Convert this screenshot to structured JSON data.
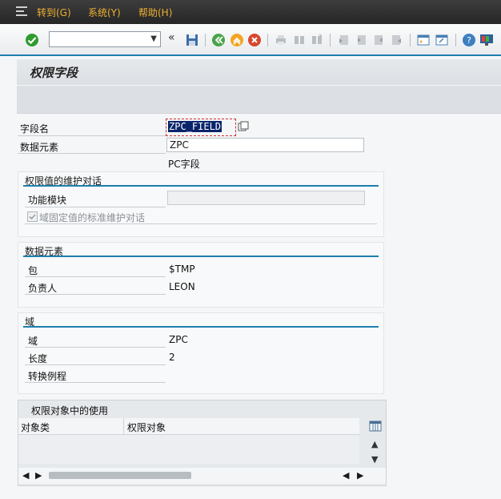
{
  "menu": {
    "goto": "转到(G)",
    "system": "系统(Y)",
    "help": "帮助(H)"
  },
  "toolbar": {
    "command_field": "",
    "icons": [
      "check-icon",
      "back-icon",
      "save-icon",
      "back-arrow-icon",
      "exit-icon",
      "cancel-icon",
      "print-icon",
      "find-icon",
      "find-next-icon",
      "first-page-icon",
      "previous-page-icon",
      "next-page-icon",
      "last-page-icon",
      "create-session-icon",
      "shortcut-icon",
      "help-icon",
      "customize-layout-icon"
    ]
  },
  "page": {
    "title": "权限字段"
  },
  "form": {
    "field_name_label": "字段名",
    "field_name_value": "ZPC_FIELD",
    "data_element_label": "数据元素",
    "data_element_value": "ZPC",
    "description": "PC字段"
  },
  "maintenance": {
    "header": "权限值的维护对话",
    "function_module_label": "功能模块",
    "function_module_value": "",
    "checkbox_label": "域固定值的标准维护对话",
    "checkbox_checked": true
  },
  "data_element_group": {
    "header": "数据元素",
    "package_label": "包",
    "package_value": "$TMP",
    "owner_label": "负责人",
    "owner_value": "LEON"
  },
  "domain_group": {
    "header": "域",
    "domain_label": "域",
    "domain_value": "ZPC",
    "length_label": "长度",
    "length_value": "2",
    "conversion_label": "转换例程",
    "conversion_value": ""
  },
  "usage_table": {
    "title": "权限对象中的使用",
    "columns": [
      "对象类",
      "权限对象"
    ],
    "rows": []
  },
  "colors": {
    "accent": "#1e7fae",
    "menu_text": "#f0b030",
    "selection": "#0a246a"
  }
}
